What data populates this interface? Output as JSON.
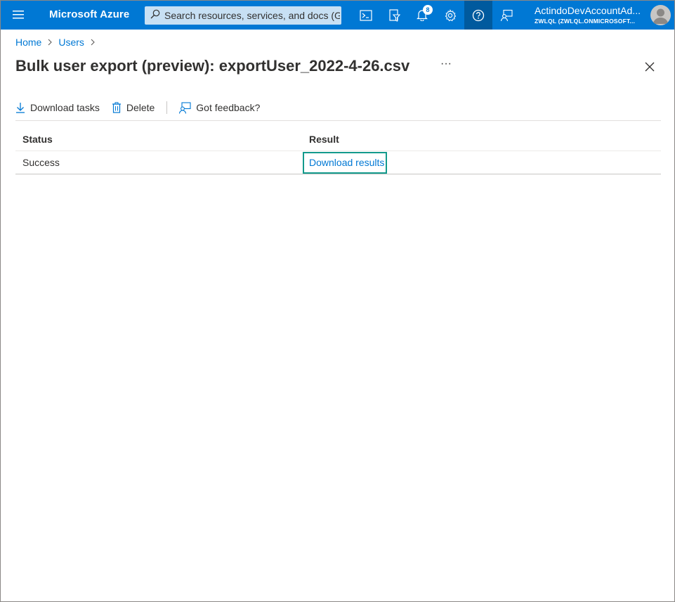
{
  "topbar": {
    "menu_icon": "hamburger-menu-icon",
    "brand": "Microsoft Azure",
    "search_placeholder": "Search resources, services, and docs (G+/)",
    "notifications_count": "8",
    "account_name": "ActindoDevAccountAd...",
    "account_directory": "ZWLQL (ZWLQL.ONMICROSOFT...",
    "icons": [
      "cloud-shell-icon",
      "directory-filter-icon",
      "notifications-bell-icon",
      "settings-gear-icon",
      "help-question-icon",
      "feedback-icon"
    ]
  },
  "breadcrumb": {
    "items": [
      "Home",
      "Users"
    ]
  },
  "page": {
    "title": "Bulk user export (preview): exportUser_2022-4-26.csv",
    "more_label": "···"
  },
  "commands": {
    "download_tasks": "Download tasks",
    "delete": "Delete",
    "feedback": "Got feedback?"
  },
  "table": {
    "columns": [
      "Status",
      "Result"
    ],
    "rows": [
      {
        "status": "Success",
        "result": "Download results"
      }
    ]
  },
  "colors": {
    "topbar": "#0078d4",
    "link": "#0078d4",
    "highlight_border": "#139a8c"
  }
}
